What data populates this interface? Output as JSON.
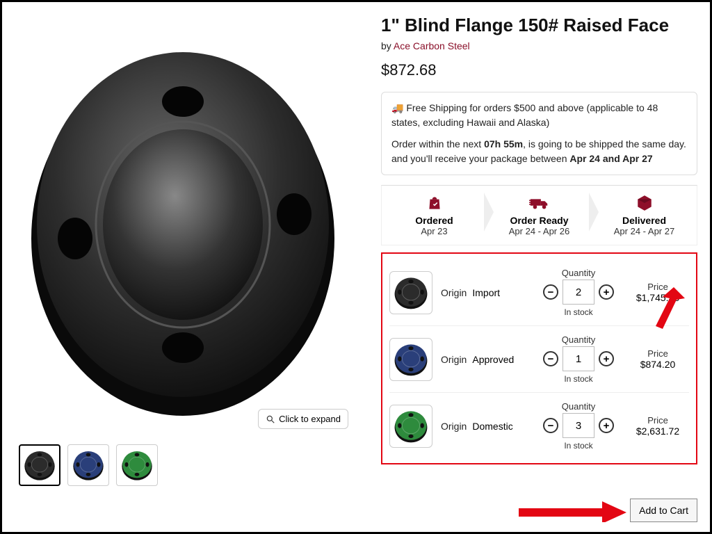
{
  "product": {
    "title": "1\" Blind Flange 150# Raised Face",
    "by_prefix": "by ",
    "vendor": "Ace Carbon Steel",
    "price": "$872.68",
    "expand_label": "Click to expand"
  },
  "shipping": {
    "free_line": "Free Shipping for orders $500 and above (applicable to 48 states, excluding Hawaii and Alaska)",
    "order_prefix": "Order within the next ",
    "countdown": "07h 55m",
    "order_mid": ", is going to be shipped the same day. and you'll receive your package between ",
    "window": "Apr 24 and Apr 27"
  },
  "timeline": {
    "ordered": {
      "label": "Ordered",
      "date": "Apr 23"
    },
    "ready": {
      "label": "Order Ready",
      "date": "Apr 24 - Apr 26"
    },
    "delivered": {
      "label": "Delivered",
      "date": "Apr 24 - Apr 27"
    }
  },
  "variants": [
    {
      "origin_label": "Origin",
      "origin": "Import",
      "qty_label": "Quantity",
      "qty": "2",
      "stock": "In stock",
      "price_label": "Price",
      "price": "$1,745.36",
      "color": "#2b2b2b"
    },
    {
      "origin_label": "Origin",
      "origin": "Approved",
      "qty_label": "Quantity",
      "qty": "1",
      "stock": "In stock",
      "price_label": "Price",
      "price": "$874.20",
      "color": "#2a3f7a"
    },
    {
      "origin_label": "Origin",
      "origin": "Domestic",
      "qty_label": "Quantity",
      "qty": "3",
      "stock": "In stock",
      "price_label": "Price",
      "price": "$2,631.72",
      "color": "#2e8b3d"
    }
  ],
  "add_to_cart": "Add to Cart",
  "thumbs": [
    {
      "color": "#2b2b2b",
      "selected": true
    },
    {
      "color": "#2a3f7a",
      "selected": false
    },
    {
      "color": "#2e8b3d",
      "selected": false
    }
  ]
}
